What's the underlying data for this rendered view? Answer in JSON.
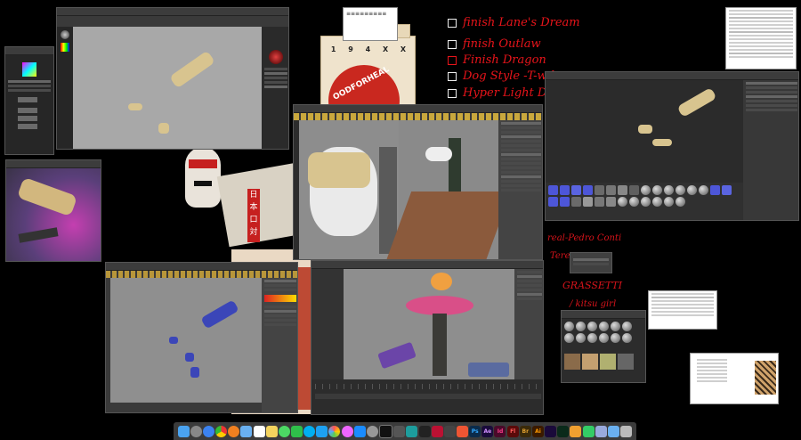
{
  "desktop": {
    "background_color": "#000000",
    "todo_list": [
      {
        "text": "finish Lane's  Dream",
        "checked": false
      },
      {
        "text": "finish Outlaw",
        "checked": false
      },
      {
        "text": "Finish Dragon",
        "checked": true
      },
      {
        "text": "Dog Style  -T-wd",
        "checked": false
      },
      {
        "text": "Hyper Light Dri",
        "checked": false
      }
    ],
    "scrawls": [
      {
        "text": "real-Pedro Conti"
      },
      {
        "text": "Tere"
      },
      {
        "text": "GRASSETTI"
      },
      {
        "text": "/ kitsu girl"
      }
    ],
    "poster": {
      "banner_text": "OODFORHEAL",
      "marks": [
        "1",
        "9",
        "4",
        "X",
        "X"
      ],
      "kanji": [
        "日",
        "本",
        "口",
        "対"
      ]
    },
    "sticky_note_text": "≡≡≡≡≡≡≡≡≡"
  },
  "windows": [
    {
      "name": "zbrush-window",
      "app": "ZBrush"
    },
    {
      "name": "zbrush-tool-palette",
      "app": "ZBrush"
    },
    {
      "name": "reference-photo-window",
      "app": "Preview"
    },
    {
      "name": "maya-center-window",
      "app": "Maya"
    },
    {
      "name": "maya-right-window",
      "app": "Maya"
    },
    {
      "name": "maya-bottom-left-window",
      "app": "Maya"
    },
    {
      "name": "maya-bottom-center-window",
      "app": "Maya"
    },
    {
      "name": "spreadsheet-top-right",
      "app": "Spreadsheet"
    },
    {
      "name": "spreadsheet-mid-right",
      "app": "Spreadsheet"
    },
    {
      "name": "texture-browser-window",
      "app": "Bridge"
    },
    {
      "name": "image-info-window",
      "app": "Preview"
    }
  ],
  "colors": {
    "ui_dark": "#2f2f2f",
    "viewport_grey": "#a7a7a7",
    "bone": "#d8c48f",
    "todo_red": "#e8141a",
    "blue_mesh": "#3b46b8",
    "floor_wood": "#8b5a3c"
  },
  "dock": {
    "icons": [
      "finder-icon",
      "launchpad-icon",
      "safari-icon",
      "chrome-icon",
      "firefox-icon",
      "mail-icon",
      "calendar-icon",
      "notes-icon",
      "messages-icon",
      "facetime-icon",
      "skype-icon",
      "twitter-icon",
      "photos-icon",
      "itunes-icon",
      "appstore-icon",
      "preferences-icon",
      "terminal-icon",
      "zbrush-icon",
      "maya-icon",
      "unity-icon",
      "substance-icon",
      "marmoset-icon",
      "keyshot-icon",
      "photoshop-icon",
      "aftereffects-icon",
      "indesign-icon",
      "flash-icon",
      "bridge-icon",
      "illustrator-icon",
      "premiere-icon",
      "dreamweaver-icon",
      "pages-icon",
      "numbers-icon",
      "preview-icon",
      "folder-icon",
      "trash-icon"
    ],
    "labels": {
      "photoshop": "Ps",
      "aftereffects": "Ae",
      "indesign": "Id",
      "flash": "Fl",
      "bridge": "Br",
      "illustrator": "Ai"
    }
  }
}
